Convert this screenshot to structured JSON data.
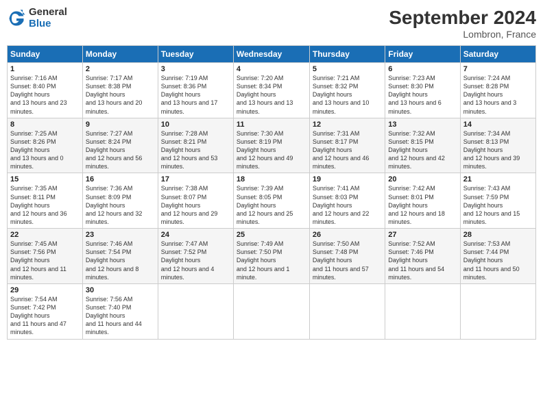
{
  "header": {
    "logo_general": "General",
    "logo_blue": "Blue",
    "month_title": "September 2024",
    "location": "Lombron, France"
  },
  "weekdays": [
    "Sunday",
    "Monday",
    "Tuesday",
    "Wednesday",
    "Thursday",
    "Friday",
    "Saturday"
  ],
  "weeks": [
    [
      {
        "day": "1",
        "sunrise": "7:16 AM",
        "sunset": "8:40 PM",
        "daylight": "13 hours and 23 minutes."
      },
      {
        "day": "2",
        "sunrise": "7:17 AM",
        "sunset": "8:38 PM",
        "daylight": "13 hours and 20 minutes."
      },
      {
        "day": "3",
        "sunrise": "7:19 AM",
        "sunset": "8:36 PM",
        "daylight": "13 hours and 17 minutes."
      },
      {
        "day": "4",
        "sunrise": "7:20 AM",
        "sunset": "8:34 PM",
        "daylight": "13 hours and 13 minutes."
      },
      {
        "day": "5",
        "sunrise": "7:21 AM",
        "sunset": "8:32 PM",
        "daylight": "13 hours and 10 minutes."
      },
      {
        "day": "6",
        "sunrise": "7:23 AM",
        "sunset": "8:30 PM",
        "daylight": "13 hours and 6 minutes."
      },
      {
        "day": "7",
        "sunrise": "7:24 AM",
        "sunset": "8:28 PM",
        "daylight": "13 hours and 3 minutes."
      }
    ],
    [
      {
        "day": "8",
        "sunrise": "7:25 AM",
        "sunset": "8:26 PM",
        "daylight": "13 hours and 0 minutes."
      },
      {
        "day": "9",
        "sunrise": "7:27 AM",
        "sunset": "8:24 PM",
        "daylight": "12 hours and 56 minutes."
      },
      {
        "day": "10",
        "sunrise": "7:28 AM",
        "sunset": "8:21 PM",
        "daylight": "12 hours and 53 minutes."
      },
      {
        "day": "11",
        "sunrise": "7:30 AM",
        "sunset": "8:19 PM",
        "daylight": "12 hours and 49 minutes."
      },
      {
        "day": "12",
        "sunrise": "7:31 AM",
        "sunset": "8:17 PM",
        "daylight": "12 hours and 46 minutes."
      },
      {
        "day": "13",
        "sunrise": "7:32 AM",
        "sunset": "8:15 PM",
        "daylight": "12 hours and 42 minutes."
      },
      {
        "day": "14",
        "sunrise": "7:34 AM",
        "sunset": "8:13 PM",
        "daylight": "12 hours and 39 minutes."
      }
    ],
    [
      {
        "day": "15",
        "sunrise": "7:35 AM",
        "sunset": "8:11 PM",
        "daylight": "12 hours and 36 minutes."
      },
      {
        "day": "16",
        "sunrise": "7:36 AM",
        "sunset": "8:09 PM",
        "daylight": "12 hours and 32 minutes."
      },
      {
        "day": "17",
        "sunrise": "7:38 AM",
        "sunset": "8:07 PM",
        "daylight": "12 hours and 29 minutes."
      },
      {
        "day": "18",
        "sunrise": "7:39 AM",
        "sunset": "8:05 PM",
        "daylight": "12 hours and 25 minutes."
      },
      {
        "day": "19",
        "sunrise": "7:41 AM",
        "sunset": "8:03 PM",
        "daylight": "12 hours and 22 minutes."
      },
      {
        "day": "20",
        "sunrise": "7:42 AM",
        "sunset": "8:01 PM",
        "daylight": "12 hours and 18 minutes."
      },
      {
        "day": "21",
        "sunrise": "7:43 AM",
        "sunset": "7:59 PM",
        "daylight": "12 hours and 15 minutes."
      }
    ],
    [
      {
        "day": "22",
        "sunrise": "7:45 AM",
        "sunset": "7:56 PM",
        "daylight": "12 hours and 11 minutes."
      },
      {
        "day": "23",
        "sunrise": "7:46 AM",
        "sunset": "7:54 PM",
        "daylight": "12 hours and 8 minutes."
      },
      {
        "day": "24",
        "sunrise": "7:47 AM",
        "sunset": "7:52 PM",
        "daylight": "12 hours and 4 minutes."
      },
      {
        "day": "25",
        "sunrise": "7:49 AM",
        "sunset": "7:50 PM",
        "daylight": "12 hours and 1 minute."
      },
      {
        "day": "26",
        "sunrise": "7:50 AM",
        "sunset": "7:48 PM",
        "daylight": "11 hours and 57 minutes."
      },
      {
        "day": "27",
        "sunrise": "7:52 AM",
        "sunset": "7:46 PM",
        "daylight": "11 hours and 54 minutes."
      },
      {
        "day": "28",
        "sunrise": "7:53 AM",
        "sunset": "7:44 PM",
        "daylight": "11 hours and 50 minutes."
      }
    ],
    [
      {
        "day": "29",
        "sunrise": "7:54 AM",
        "sunset": "7:42 PM",
        "daylight": "11 hours and 47 minutes."
      },
      {
        "day": "30",
        "sunrise": "7:56 AM",
        "sunset": "7:40 PM",
        "daylight": "11 hours and 44 minutes."
      },
      null,
      null,
      null,
      null,
      null
    ]
  ]
}
